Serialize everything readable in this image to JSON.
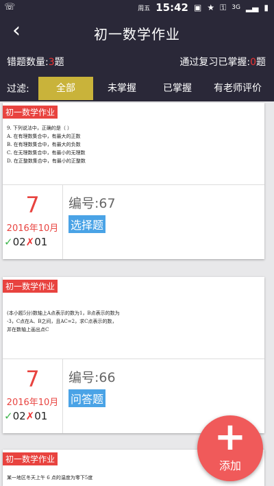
{
  "status": {
    "left_icon": "notification-icon",
    "day": "周五",
    "time": "15:42",
    "network": "3G",
    "icons": [
      "cast-icon",
      "star-icon",
      "key-icon",
      "signal-icon",
      "battery-icon"
    ]
  },
  "header": {
    "back_icon": "‹",
    "title": "初一数学作业"
  },
  "stats": {
    "wrong_label": "错题数量:",
    "wrong_count": "3",
    "wrong_unit": "题",
    "mastered_label": "通过复习已掌握:",
    "mastered_count": "0",
    "mastered_unit": "题"
  },
  "filter": {
    "label": "过滤:",
    "tabs": [
      {
        "label": "全部",
        "active": true
      },
      {
        "label": "未掌握",
        "active": false
      },
      {
        "label": "已掌握",
        "active": false
      },
      {
        "label": "有老师评价",
        "active": false
      }
    ]
  },
  "cards": [
    {
      "tag": "初一数学作业",
      "lines": [
        "9. 下列说法中，正确的是（    ）",
        "A. 在有理数集合中，有最大的正数",
        "B. 在有理数集合中，有最大的负数",
        "C. 在无理数集合中，有最小的无理数",
        "D. 在正整数集合中，有最小的正整数"
      ],
      "day": "7",
      "month": "2016年10月",
      "correct_icon": "✓",
      "correct": "02",
      "wrong_icon": "✗",
      "wrong": "01",
      "code": "编号:67",
      "qtype": "选择题"
    },
    {
      "tag": "初一数学作业",
      "lines": [
        "(本小题5分)数轴上A点表示的数为1，B点表示的数为",
        "-3，C点在A、B之间，且AC=2，求C点表示的数，",
        "并在数轴上画出点C"
      ],
      "day": "7",
      "month": "2016年10月",
      "correct_icon": "✓",
      "correct": "02",
      "wrong_icon": "✗",
      "wrong": "01",
      "code": "编号:66",
      "qtype": "问答题"
    },
    {
      "tag": "初一数学作业",
      "lines": [
        "某一地区冬天上午 6 点的温度为零下5度"
      ]
    }
  ],
  "fab": {
    "icon": "+",
    "label": "添加"
  },
  "colors": {
    "header_bg": "#2a2838",
    "active_tab": "#c9b33a",
    "accent_red": "#e8433f",
    "tag_blue": "#4aa3e6",
    "correct_green": "#3cb34a"
  }
}
